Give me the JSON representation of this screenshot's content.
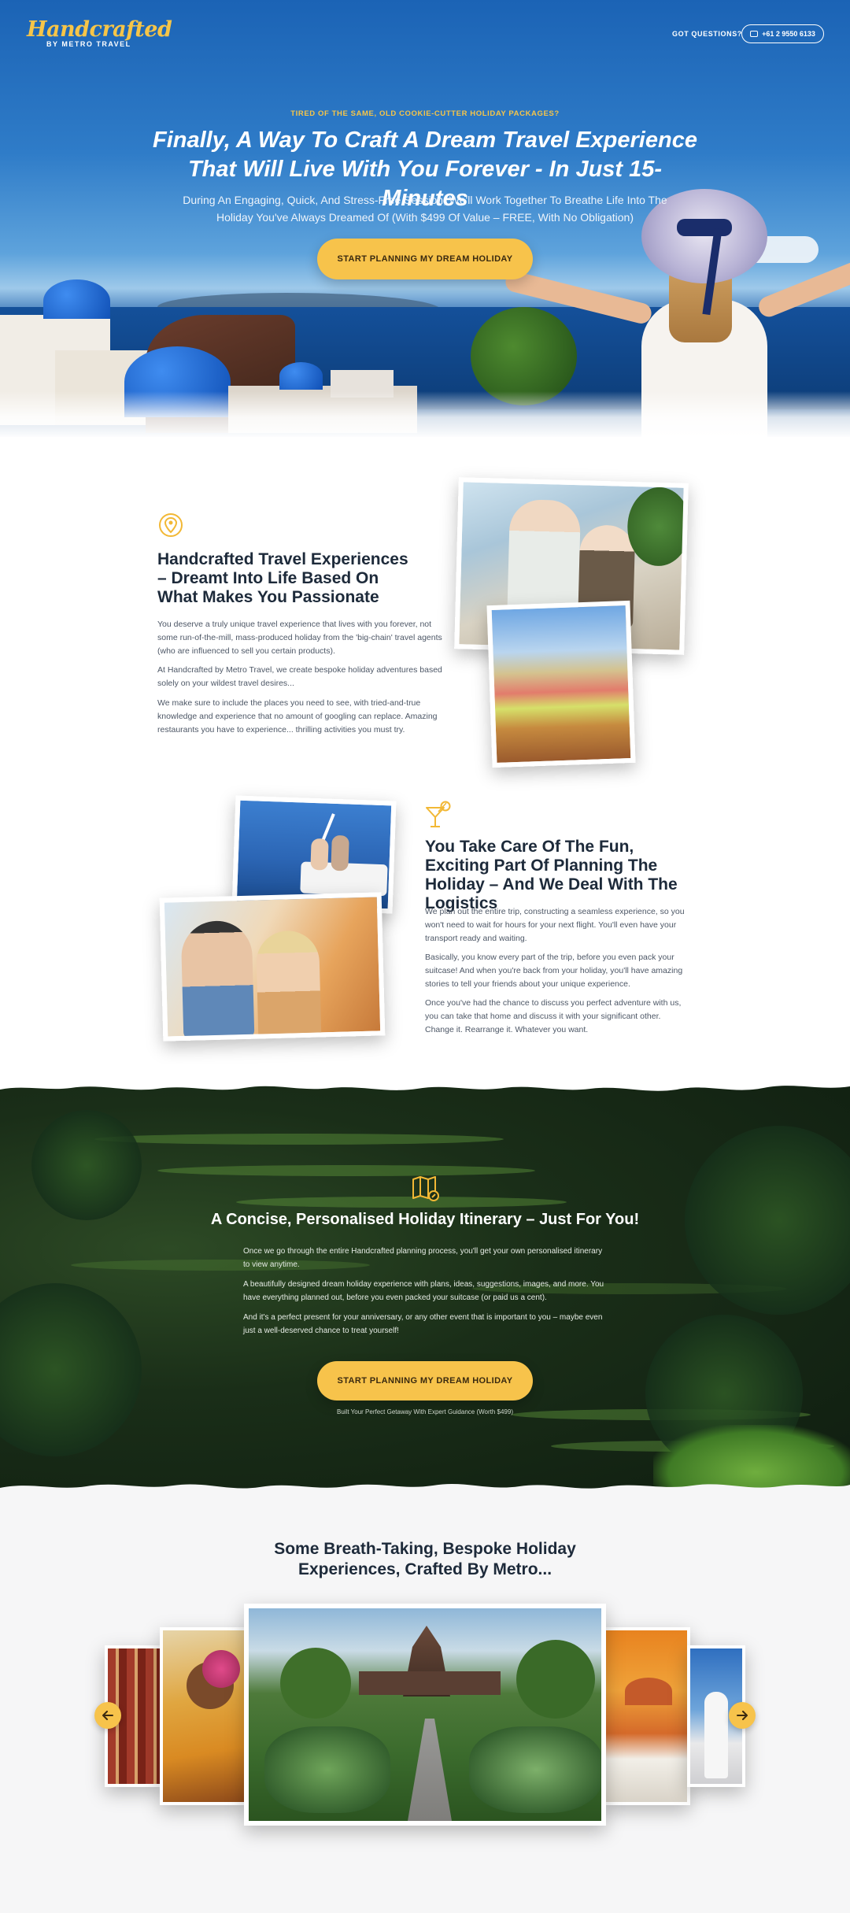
{
  "header": {
    "logo_script": "Handcrafted",
    "logo_sub": "BY METRO TRAVEL",
    "questions_label": "GOT QUESTIONS?",
    "phone": "+61 2 9550 6133"
  },
  "hero": {
    "kicker": "TIRED OF THE SAME, OLD COOKIE-CUTTER HOLIDAY PACKAGES?",
    "title": "Finally, A Way To Craft A Dream Travel Experience That Will Live With You Forever - In Just 15-Minutes",
    "subtitle": "During An Engaging, Quick, And Stress-Free Session, We'll Work Together To Breathe Life Into The Holiday You've Always Dreamed Of (With $499 Of Value – FREE, With No Obligation)",
    "cta": "START PLANNING MY DREAM HOLIDAY"
  },
  "feature1": {
    "icon": "map-pin-icon",
    "title": "Handcrafted Travel Experiences – Dreamt Into Life Based On What Makes You Passionate",
    "p1": "You deserve a truly unique travel experience that lives with you forever, not some run-of-the-mill, mass-produced holiday from the 'big-chain' travel agents (who are influenced to sell you certain products).",
    "p2": "At Handcrafted by Metro Travel, we create bespoke holiday adventures based solely on your wildest travel desires...",
    "p3": "We make sure to include the places you need to see, with tried-and-true knowledge and experience that no amount of googling can replace. Amazing restaurants you have to experience... thrilling activities you must try."
  },
  "feature2": {
    "icon": "cocktail-icon",
    "title": "You Take Care Of The Fun, Exciting Part Of Planning The Holiday – And We Deal With The Logistics",
    "p1": "We plan out the entire trip, constructing a seamless experience, so you won't need to wait for hours for your next flight. You'll even have your transport ready and waiting.",
    "p2": "Basically, you know every part of the trip, before you even pack your suitcase! And when you're back from your holiday, you'll have amazing stories to tell your friends about your unique experience.",
    "p3": "Once you've had the chance to discuss you perfect adventure with us, you can take that home and discuss it with your significant other. Change it. Rearrange it. Whatever you want."
  },
  "itinerary": {
    "icon": "map-icon",
    "title": "A Concise, Personalised Holiday Itinerary – Just For You!",
    "p1": "Once we go through the entire Handcrafted planning process, you'll get your own personalised itinerary to view anytime.",
    "p2": "A beautifully designed dream holiday experience with plans, ideas, suggestions, images, and more. You have everything planned out, before you even packed your suitcase (or paid us a cent).",
    "p3": "And it's a perfect present for your anniversary, or any other event that is important to you – maybe even just a well-deserved chance to treat yourself!",
    "cta": "START PLANNING MY DREAM HOLIDAY",
    "note": "Built Your Perfect Getaway With Expert Guidance (Worth $499)"
  },
  "gallery": {
    "title": "Some Breath-Taking, Bespoke Holiday Experiences, Crafted By Metro...",
    "prev_icon": "arrow-left-icon",
    "next_icon": "arrow-right-icon"
  },
  "colors": {
    "accent": "#f7c34b",
    "navy": "#1d2a3a",
    "hero_blue": "#1b63b5"
  }
}
